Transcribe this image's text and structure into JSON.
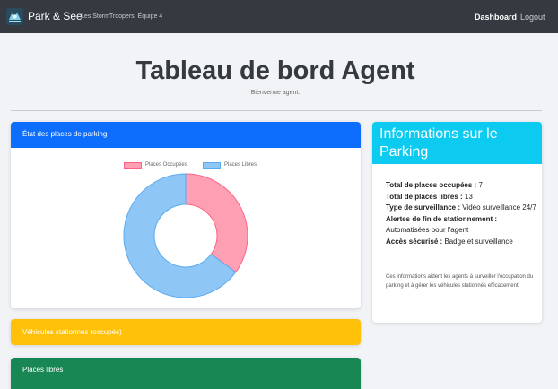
{
  "navbar": {
    "logo_icon": "parking-logo-icon",
    "brand": "Park & See",
    "team": "Les StormTroopers, Équipe 4",
    "links": {
      "dashboard": "Dashboard",
      "logout": "Logout"
    }
  },
  "page": {
    "title": "Tableau de bord Agent",
    "welcome": "Bienvenue agent."
  },
  "parking_card": {
    "header": "État des places de parking",
    "header_color": "#0d6efd"
  },
  "chart_data": {
    "type": "pie",
    "donut": true,
    "categories": [
      "Places Occupées",
      "Places Libres"
    ],
    "values": [
      7,
      13
    ],
    "colors": [
      "#ff9fb3",
      "#8ec7f5"
    ],
    "borders": [
      "#ff6384",
      "#5aaaf0"
    ],
    "legend": "top"
  },
  "info_card": {
    "header": "Informations sur le Parking",
    "header_color": "#0dcaf0",
    "items": [
      {
        "label": "Total de places occupées :",
        "value": "7"
      },
      {
        "label": "Total de places libres :",
        "value": "13"
      },
      {
        "label": "Type de surveillance :",
        "value": "Vidéo surveillance 24/7"
      },
      {
        "label": "Alertes de fin de stationnement :",
        "value": "Automatisées pour l'agent"
      },
      {
        "label": "Accès sécurisé :",
        "value": "Badge et surveillance"
      }
    ],
    "note": "Ces informations aident les agents à surveiller l'occupation du parking et à gérer les véhicules stationnés efficacement."
  },
  "vehicles_card": {
    "header": "Véhicules stationnés (occupés)",
    "color": "#ffc107"
  },
  "free_card": {
    "header": "Places libres",
    "color": "#198754"
  }
}
